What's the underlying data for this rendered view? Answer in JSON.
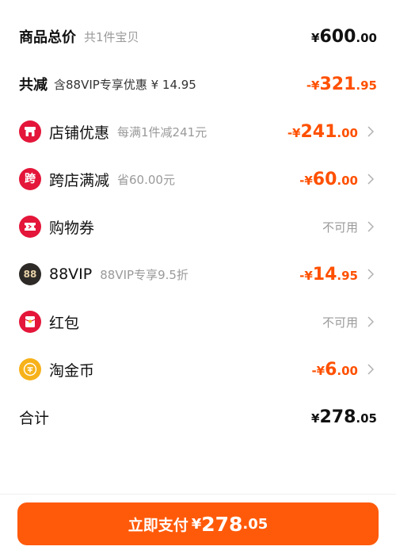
{
  "summary": {
    "total": {
      "label": "商品总价",
      "note": "共1件宝贝",
      "currency": "¥",
      "int": "600",
      "dec": ".00"
    },
    "reduce": {
      "label": "共减",
      "note": "含88VIP专享优惠 ¥ 14.95",
      "currency": "-¥",
      "int": "321",
      "dec": ".95"
    }
  },
  "rows": [
    {
      "label": "店铺优惠",
      "note": "每满1件减241元",
      "currency": "-¥",
      "int": "241",
      "dec": ".00",
      "icon": "store-icon",
      "icon_color": "#e4163a"
    },
    {
      "label": "跨店满减",
      "note": "省60.00元",
      "currency": "-¥",
      "int": "60",
      "dec": ".00",
      "icon": "cross-store-icon",
      "icon_color": "#e4163a",
      "icon_char": "跨"
    },
    {
      "label": "购物券",
      "status": "不可用",
      "icon": "coupon-icon",
      "icon_color": "#e4163a"
    },
    {
      "label": "88VIP",
      "note": "88VIP专享9.5折",
      "currency": "-¥",
      "int": "14",
      "dec": ".95",
      "icon": "vip-icon",
      "icon_color": "#2e2a27",
      "icon_char": "88"
    },
    {
      "label": "红包",
      "status": "不可用",
      "icon": "red-packet-icon",
      "icon_color": "#e4163a"
    },
    {
      "label": "淘金币",
      "currency": "-¥",
      "int": "6",
      "dec": ".00",
      "icon": "gold-coin-icon",
      "icon_color": "#f7b21a"
    }
  ],
  "subtotal": {
    "label": "合计",
    "currency": "¥",
    "int": "278",
    "dec": ".05"
  },
  "pay": {
    "label": "立即支付",
    "currency": "¥",
    "int": "278",
    "dec": ".05"
  },
  "colors": {
    "accent": "#ff5000",
    "button": "#ff5a0a",
    "muted": "#9a9a9a"
  }
}
